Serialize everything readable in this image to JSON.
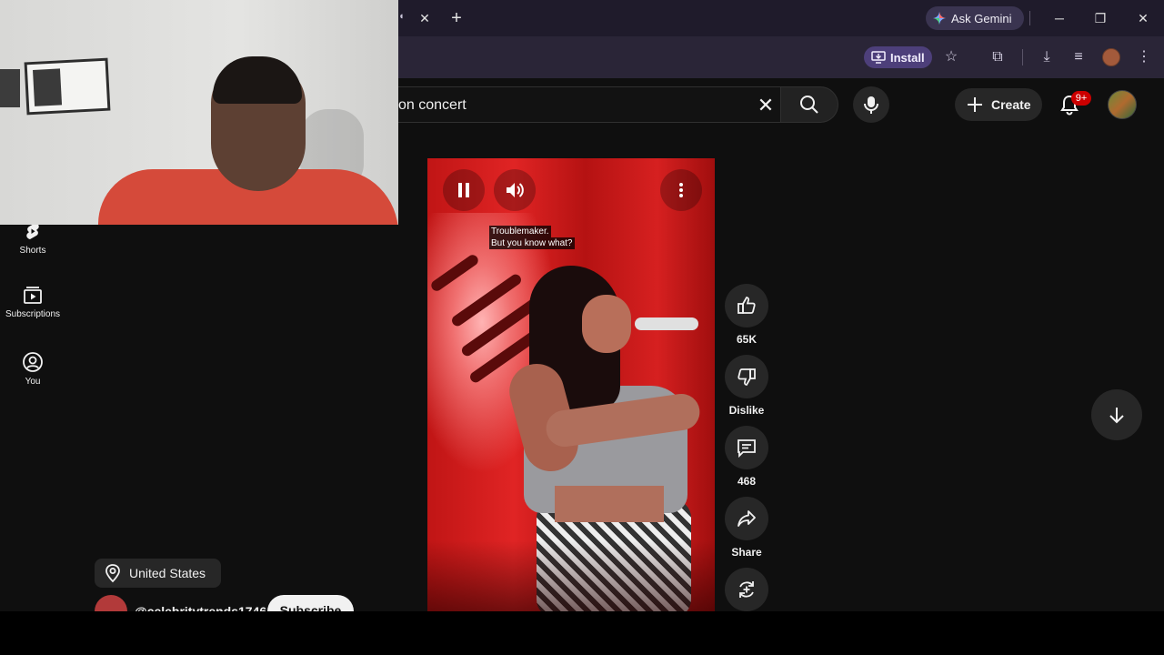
{
  "browser": {
    "tab_audio_icon": "speaker-icon",
    "ask_gemini_label": "Ask Gemini",
    "install_label": "Install"
  },
  "header": {
    "search_value": "on concert",
    "create_label": "Create",
    "notification_badge": "9+"
  },
  "sidebar": {
    "items": [
      {
        "label": "Shorts",
        "icon": "shorts-icon"
      },
      {
        "label": "Subscriptions",
        "icon": "subscriptions-icon"
      },
      {
        "label": "You",
        "icon": "you-icon"
      }
    ]
  },
  "video": {
    "caption_lines": [
      "Troublemaker.",
      "But you know what?"
    ],
    "likes": "65K",
    "dislike_label": "Dislike",
    "comments": "468",
    "share_label": "Share"
  },
  "footer": {
    "location": "United States",
    "channel_handle": "@celebritytrends1746",
    "subscribe_label": "Subscribe"
  },
  "colors": {
    "background": "#0f0f0f",
    "chip": "#272727",
    "badge": "#cc0000",
    "install_chip": "#4d3f7a"
  }
}
